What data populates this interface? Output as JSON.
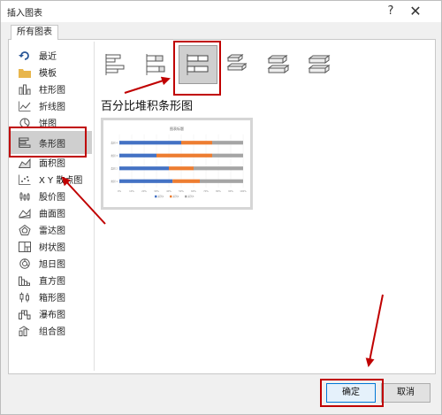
{
  "dialog": {
    "title": "插入图表",
    "help_glyph": "?",
    "close_glyph": "✕"
  },
  "tabs": [
    {
      "label": "所有图表"
    }
  ],
  "sidebar": {
    "items": [
      {
        "label": "最近",
        "icon": "recent-icon"
      },
      {
        "label": "模板",
        "icon": "folder-icon"
      },
      {
        "label": "柱形图",
        "icon": "column-chart-icon"
      },
      {
        "label": "折线图",
        "icon": "line-chart-icon"
      },
      {
        "label": "饼图",
        "icon": "pie-chart-icon"
      },
      {
        "label": "条形图",
        "icon": "bar-chart-icon",
        "selected": true
      },
      {
        "label": "面积图",
        "icon": "area-chart-icon"
      },
      {
        "label": "X Y 散点图",
        "icon": "scatter-chart-icon"
      },
      {
        "label": "股价图",
        "icon": "stock-chart-icon"
      },
      {
        "label": "曲面图",
        "icon": "surface-chart-icon"
      },
      {
        "label": "雷达图",
        "icon": "radar-chart-icon"
      },
      {
        "label": "树状图",
        "icon": "treemap-chart-icon"
      },
      {
        "label": "旭日图",
        "icon": "sunburst-chart-icon"
      },
      {
        "label": "直方图",
        "icon": "histogram-chart-icon"
      },
      {
        "label": "箱形图",
        "icon": "box-whisker-chart-icon"
      },
      {
        "label": "瀑布图",
        "icon": "waterfall-chart-icon"
      },
      {
        "label": "组合图",
        "icon": "combo-chart-icon"
      }
    ]
  },
  "main": {
    "selected_type_title": "百分比堆积条形图",
    "subtypes": [
      {
        "icon": "clustered-bar-icon"
      },
      {
        "icon": "stacked-bar-icon"
      },
      {
        "icon": "percent-stacked-bar-icon",
        "selected": true
      },
      {
        "icon": "3d-clustered-bar-icon"
      },
      {
        "icon": "3d-stacked-bar-icon"
      },
      {
        "icon": "3d-percent-stacked-bar-icon"
      }
    ],
    "preview": {
      "chart_data": {
        "type": "bar",
        "title": "图表标题",
        "categories": [
          "类别 4",
          "类别 3",
          "类别 2",
          "类别 1"
        ],
        "series": [
          {
            "name": "系列1",
            "values": [
              50,
              30,
              40,
              43
            ]
          },
          {
            "name": "系列2",
            "values": [
              25,
              45,
              20,
              22
            ]
          },
          {
            "name": "系列3",
            "values": [
              25,
              25,
              40,
              35
            ]
          }
        ],
        "x_ticks": [
          "0%",
          "10%",
          "20%",
          "30%",
          "40%",
          "50%",
          "60%",
          "70%",
          "80%",
          "90%",
          "100%"
        ],
        "xlim": [
          0,
          100
        ],
        "legend": "bottom",
        "colors": [
          "#4472c4",
          "#ed7d31",
          "#a5a5a5"
        ]
      }
    }
  },
  "buttons": {
    "ok": "确定",
    "cancel": "取消"
  },
  "colors": {
    "annotation_red": "#c00000",
    "accent": "#0078d7"
  }
}
